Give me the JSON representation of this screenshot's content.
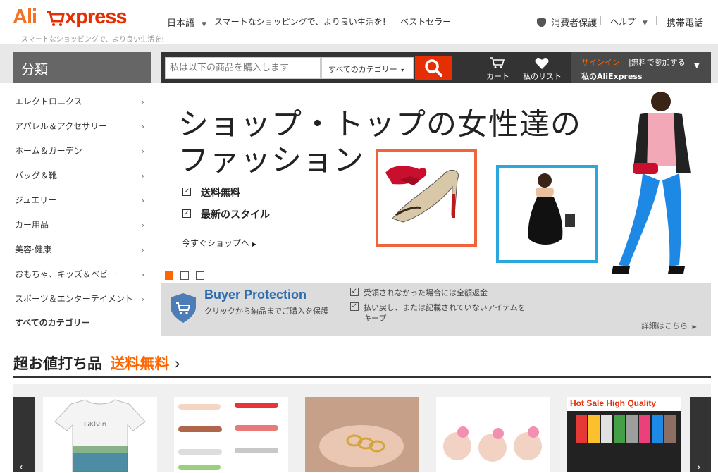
{
  "logo": {
    "text_ali": "Ali",
    "text_express": "xpress",
    "tagline": "スマートなショッピングで、より良い生活を!"
  },
  "topnav": {
    "language": "日本語",
    "slogan": "スマートなショッピングで、より良い生活を!",
    "bestseller": "ベストセラー",
    "consumer_protection": "消費者保護",
    "help": "ヘルプ",
    "mobile": "携帯電話"
  },
  "categories": {
    "header": "分類",
    "items": [
      {
        "label": "エレクトロニクス",
        "arrow": "›"
      },
      {
        "label": "アパレル＆アクセサリー",
        "arrow": "›"
      },
      {
        "label": "ホーム＆ガーデン",
        "arrow": "›"
      },
      {
        "label": "バッグ＆靴",
        "arrow": "›"
      },
      {
        "label": "ジュエリー",
        "arrow": "›"
      },
      {
        "label": "カー用品",
        "arrow": "›"
      },
      {
        "label": "美容·健康",
        "arrow": "›"
      },
      {
        "label": "おもちゃ、キッズ＆ベビー",
        "arrow": "›"
      },
      {
        "label": "スポーツ＆エンターテイメント",
        "arrow": "›"
      }
    ],
    "all": "すべてのカテゴリー"
  },
  "search": {
    "placeholder": "私は以下の商品を購入します",
    "category": "すべてのカテゴリー"
  },
  "header_actions": {
    "cart": "カート",
    "wishlist": "私のリスト",
    "signin": "サインイン",
    "register": "無料で参加する",
    "my_account": "私のAliExpress"
  },
  "banner": {
    "title_line1": "ショップ・トップの女性達の",
    "title_line2": "ファッション",
    "feature1": "送料無料",
    "feature2": "最新のスタイル",
    "cta": "今すぐショップへ",
    "slides": 3,
    "active_slide": 1
  },
  "buyer_protection": {
    "title": "Buyer Protection",
    "subtitle": "クリックから納品までご購入を保護",
    "point1": "受領されなかった場合には全額返金",
    "point2": "払い戻し、または記載されていないアイテムを",
    "point2_cont": "キープ",
    "details": "詳細はこちら"
  },
  "deals": {
    "title": "超お値打ち品",
    "highlight": "送料無料",
    "hot_sale_label": "Hot Sale High Quality",
    "products": [
      {
        "name": "t-shirt"
      },
      {
        "name": "belts"
      },
      {
        "name": "ring"
      },
      {
        "name": "baby-headbands"
      },
      {
        "name": "underwear-box"
      }
    ]
  },
  "colors": {
    "brand_red": "#e62e04",
    "orange": "#f60",
    "bp_blue": "#2b6cb0",
    "frame_orange": "#f0643c",
    "frame_blue": "#2ba6de"
  }
}
